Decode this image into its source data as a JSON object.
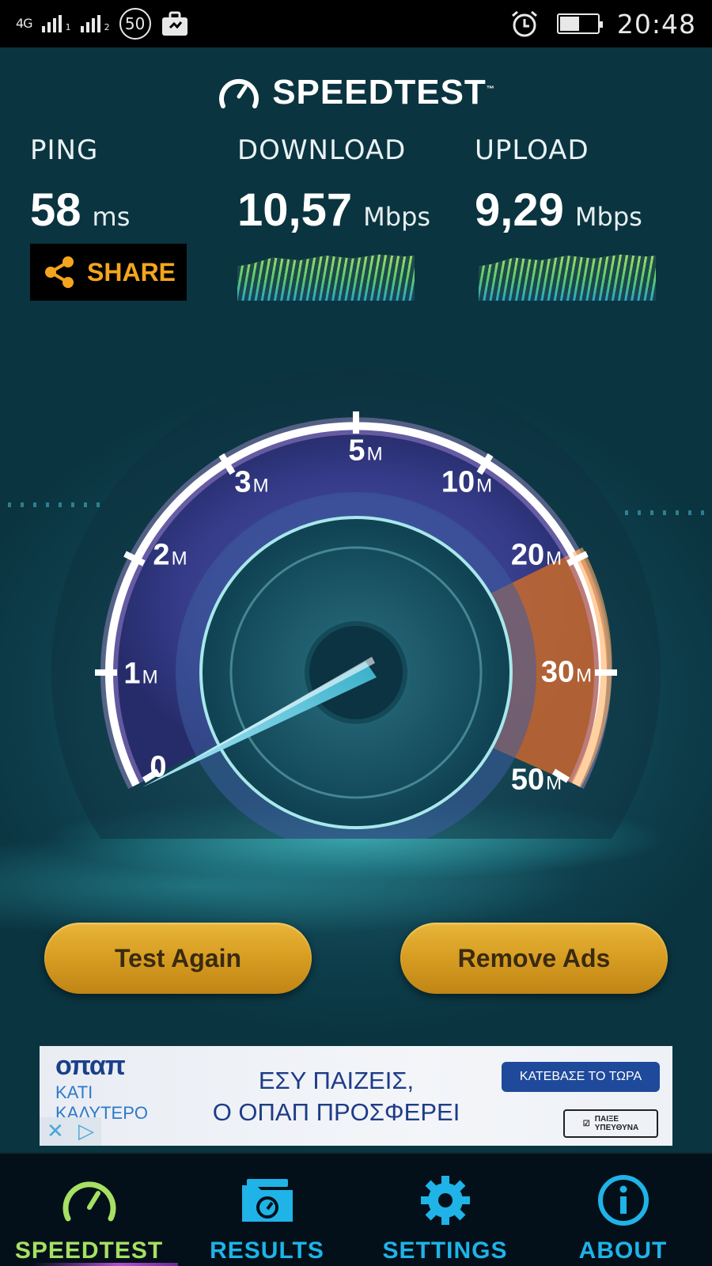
{
  "status_bar": {
    "network": "4G",
    "sim1": "1",
    "sim2": "2",
    "notification_count": "50",
    "time": "20:48"
  },
  "header": {
    "logo_text": "SPEEDTEST",
    "logo_tm": "™"
  },
  "results": {
    "ping": {
      "label": "PING",
      "value": "58",
      "unit": "ms"
    },
    "download": {
      "label": "DOWNLOAD",
      "value": "10,57",
      "unit": "Mbps"
    },
    "upload": {
      "label": "UPLOAD",
      "value": "9,29",
      "unit": "Mbps"
    }
  },
  "share_label": "SHARE",
  "gauge": {
    "labels": [
      {
        "num": "0",
        "suffix": ""
      },
      {
        "num": "1",
        "suffix": "M"
      },
      {
        "num": "2",
        "suffix": "M"
      },
      {
        "num": "3",
        "suffix": "M"
      },
      {
        "num": "5",
        "suffix": "M"
      },
      {
        "num": "10",
        "suffix": "M"
      },
      {
        "num": "20",
        "suffix": "M"
      },
      {
        "num": "30",
        "suffix": "M"
      },
      {
        "num": "50",
        "suffix": "M"
      }
    ],
    "needle_value_mbps": 0
  },
  "buttons": {
    "test_again": "Test Again",
    "remove_ads": "Remove Ads"
  },
  "ad": {
    "brand": "οπαπ",
    "tagline_1": "ΚΑΤΙ",
    "tagline_2": "ΚΑΛΥΤΕΡΟ",
    "headline_1": "ΕΣΥ ΠΑΙΖΕΙΣ,",
    "headline_2": "Ο ΟΠΑΠ ΠΡΟΣΦΕΡΕΙ",
    "cta": "ΚΑΤΕΒΑΣΕ ΤΟ ΤΩΡΑ",
    "badge_1": "ΠΑΙΞΕ",
    "badge_2": "ΥΠΕΥΘΥΝΑ"
  },
  "nav": {
    "items": [
      {
        "label": "SPEEDTEST",
        "icon": "speedometer-icon",
        "active": true
      },
      {
        "label": "RESULTS",
        "icon": "folder-gauge-icon",
        "active": false
      },
      {
        "label": "SETTINGS",
        "icon": "gear-icon",
        "active": false
      },
      {
        "label": "ABOUT",
        "icon": "info-icon",
        "active": false
      }
    ]
  },
  "colors": {
    "accent_orange": "#f4a51e",
    "nav_active": "#a6e064",
    "nav_inactive": "#1fb3e8",
    "button_gold": "#d89f23"
  }
}
